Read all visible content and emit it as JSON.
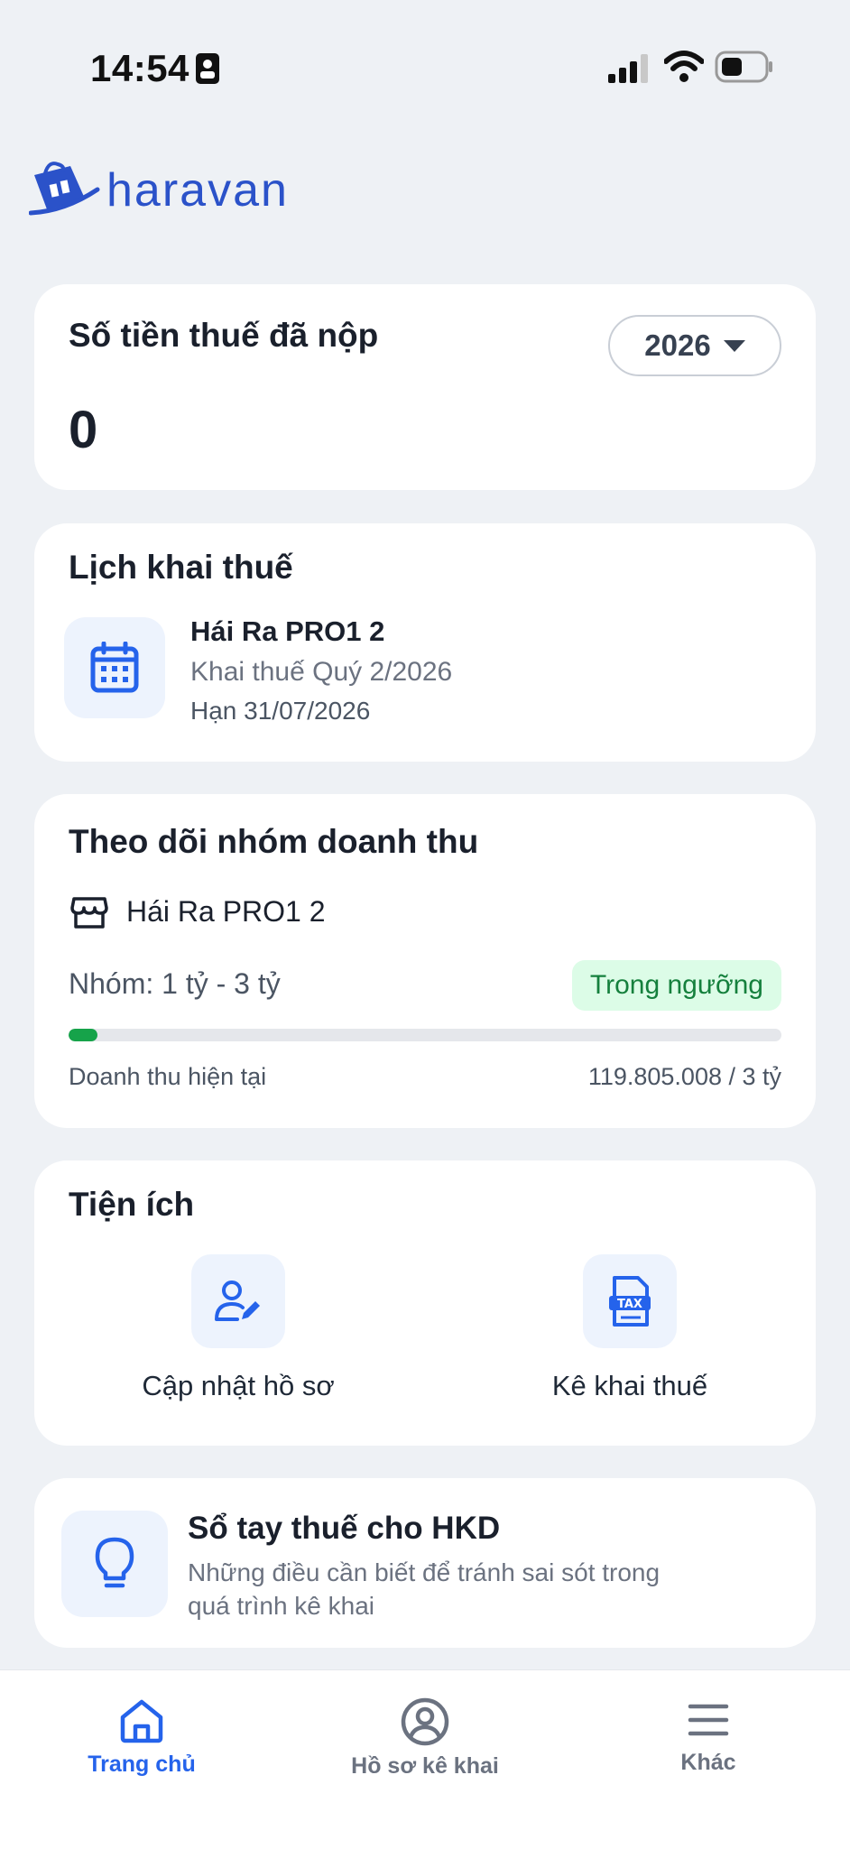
{
  "status_bar": {
    "time": "14:54"
  },
  "brand": {
    "name": "haravan"
  },
  "tax_paid": {
    "title": "Số tiền thuế đã nộp",
    "amount": "0",
    "year": "2026"
  },
  "tax_calendar": {
    "title": "Lịch khai thuế",
    "shop": "Hái Ra PRO1 2",
    "period": "Khai thuế Quý 2/2026",
    "deadline": "Hạn 31/07/2026"
  },
  "revenue_tracking": {
    "title": "Theo dõi nhóm doanh thu",
    "shop": "Hái Ra PRO1 2",
    "group": "Nhóm: 1 tỷ - 3 tỷ",
    "status": "Trong ngưỡng",
    "progress_fraction": 0.04,
    "current_label": "Doanh thu hiện tại",
    "current_value": "119.805.008 / 3 tỷ"
  },
  "utilities": {
    "title": "Tiện ích",
    "items": [
      {
        "label": "Cập nhật hồ sơ",
        "icon": "user-edit-icon"
      },
      {
        "label": "Kê khai thuế",
        "icon": "tax-document-icon"
      }
    ]
  },
  "handbook": {
    "title": "Sổ tay thuế cho HKD",
    "description": "Những điều cần biết để tránh sai sót trong quá trình kê khai"
  },
  "nav": {
    "items": [
      {
        "label": "Trang chủ",
        "icon": "home-icon",
        "active": true
      },
      {
        "label": "Hồ sơ kê khai",
        "icon": "user-circle-icon",
        "active": false
      },
      {
        "label": "Khác",
        "icon": "menu-icon",
        "active": false
      }
    ]
  },
  "colors": {
    "brand": "#2b52c9",
    "accent": "#2563eb",
    "success": "#16a34a",
    "success_bg": "#dcfce7"
  }
}
